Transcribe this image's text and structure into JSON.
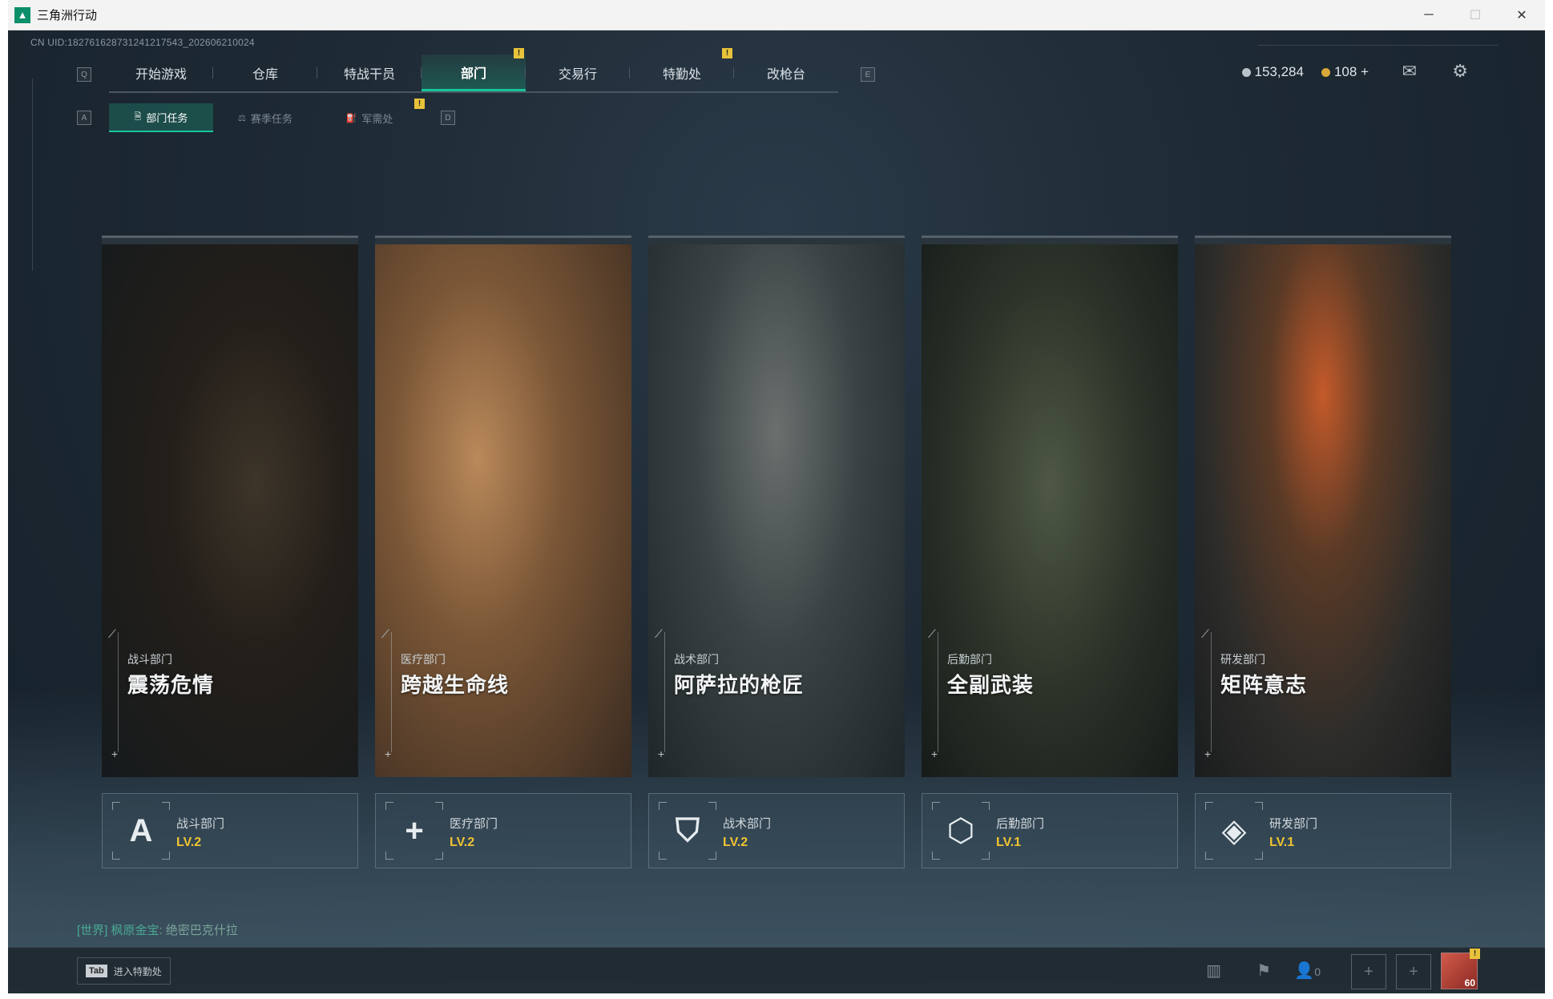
{
  "window": {
    "title": "三角洲行动",
    "controls": {
      "minimize": "─",
      "maximize": "☐",
      "close": "✕"
    }
  },
  "uid_text": "CN UID:1827616287312412175 43_20260621002 4",
  "uid_display": "CN UID:18276162873124121754 3_202606210024",
  "uid": "CN UID:182761628731241217543_202606210024",
  "keyhints": {
    "q": "Q",
    "e": "E",
    "a": "A",
    "d": "D"
  },
  "main_tabs": [
    {
      "label": "开始游戏"
    },
    {
      "label": "仓库"
    },
    {
      "label": "特战干员"
    },
    {
      "label": "部门",
      "active": true,
      "badge": "!"
    },
    {
      "label": "交易行"
    },
    {
      "label": "特勤处",
      "badge": "!"
    },
    {
      "label": "改枪台"
    }
  ],
  "sub_tabs": [
    {
      "label": "部门任务",
      "active": true
    },
    {
      "label": "赛季任务"
    },
    {
      "label": "军需处",
      "badge": "!"
    }
  ],
  "currency": {
    "silver": "153,284",
    "gold": "108",
    "add": "+"
  },
  "cards": [
    {
      "dept": "战斗部门",
      "title": "震荡危情",
      "level": "LV.2",
      "icon": "combat-dept-icon"
    },
    {
      "dept": "医疗部门",
      "title": "跨越生命线",
      "level": "LV.2",
      "icon": "medical-dept-icon"
    },
    {
      "dept": "战术部门",
      "title": "阿萨拉的枪匠",
      "level": "LV.2",
      "icon": "tactical-dept-icon"
    },
    {
      "dept": "后勤部门",
      "title": "全副武装",
      "level": "LV.1",
      "icon": "logistics-dept-icon"
    },
    {
      "dept": "研发部门",
      "title": "矩阵意志",
      "level": "LV.1",
      "icon": "research-dept-icon"
    }
  ],
  "chat": {
    "channel": "[世界]",
    "user": "枫原金宝",
    "message": "绝密巴克什拉"
  },
  "bottom": {
    "tab_key": "Tab",
    "tab_label": "进入特勤处",
    "friends_count": "0",
    "avatar_level": "60"
  },
  "colors": {
    "accent": "#17c69a",
    "level": "#f0c431",
    "badge": "#e8c23a"
  }
}
